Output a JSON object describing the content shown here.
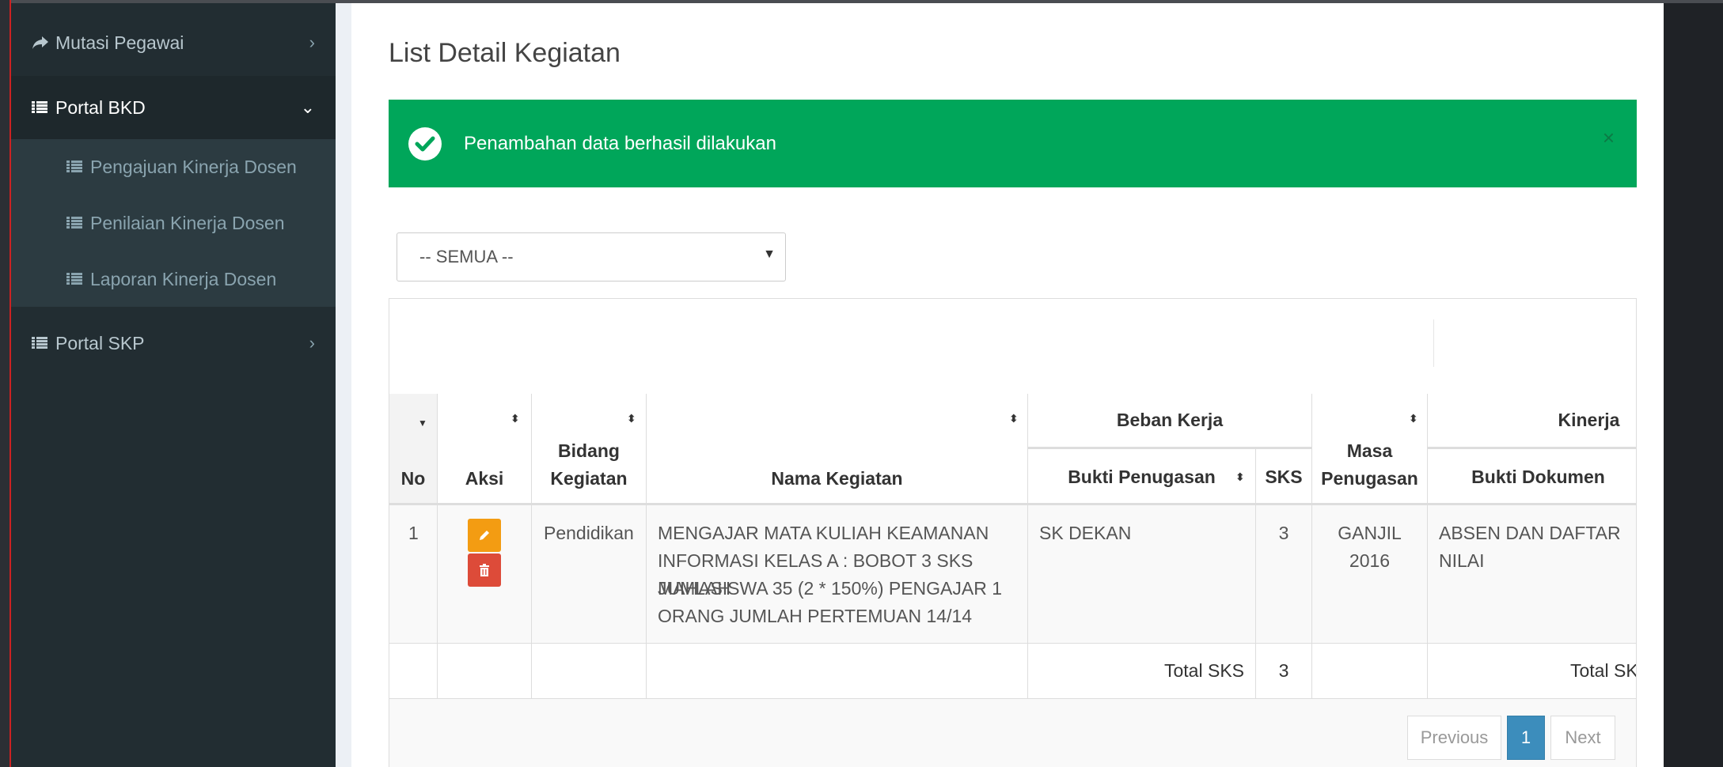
{
  "sidebar": {
    "items": [
      {
        "label": "Mutasi Pegawai",
        "icon": "share-arrow-icon"
      },
      {
        "label": "Portal BKD",
        "icon": "list-icon"
      },
      {
        "label": "Portal SKP",
        "icon": "list-icon"
      }
    ],
    "submenu": [
      {
        "label": "Pengajuan Kinerja Dosen"
      },
      {
        "label": "Penilaian Kinerja Dosen"
      },
      {
        "label": "Laporan Kinerja Dosen"
      }
    ]
  },
  "page": {
    "title": "List Detail Kegiatan"
  },
  "alert": {
    "message": "Penambahan data berhasil dilakukan",
    "close": "×",
    "color": "#00a65a"
  },
  "filter": {
    "selected": "-- SEMUA --"
  },
  "table": {
    "headers": {
      "no": "No",
      "aksi": "Aksi",
      "bidang_line1": "Bidang",
      "bidang_line2": "Kegiatan",
      "nama": "Nama Kegiatan",
      "beban_kerja": "Beban Kerja",
      "bukti_penugasan": "Bukti Penugasan",
      "sks": "SKS",
      "masa_line1": "Masa",
      "masa_line2": "Penugasan",
      "kinerja": "Kinerja",
      "bukti_dokumen": "Bukti Dokumen"
    },
    "rows": [
      {
        "no": "1",
        "bidang": "Pendidikan",
        "nama_lines": [
          "MENGAJAR MATA KULIAH KEAMANAN",
          "INFORMASI KELAS A : BOBOT 3 SKS JUMLAH",
          "MAHASISWA 35 (2 * 150%) PENGAJAR 1",
          "ORANG JUMLAH PERTEMUAN 14/14"
        ],
        "bukti_penugasan": "SK DEKAN",
        "sks": "3",
        "masa_line1": "GANJIL",
        "masa_line2": "2016",
        "bukti_dokumen_line1": "ABSEN DAN DAFTAR",
        "bukti_dokumen_line2": "NILAI"
      }
    ],
    "footer": {
      "total_label": "Total SKS",
      "total_sks": "3",
      "total_label_kinerja": "Total SKS"
    }
  },
  "pagination": {
    "previous": "Previous",
    "current": "1",
    "next": "Next"
  }
}
